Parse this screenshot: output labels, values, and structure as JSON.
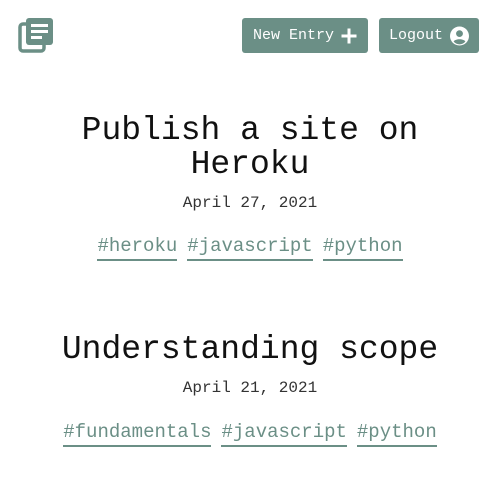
{
  "header": {
    "logo_icon": "journal-icon",
    "new_entry_label": "New Entry",
    "new_entry_icon": "plus-icon",
    "logout_label": "Logout",
    "logout_icon": "user-circle-icon"
  },
  "colors": {
    "accent": "#6b8f86",
    "text": "#111111"
  },
  "entries": [
    {
      "title": "Publish a site on Heroku",
      "date": "April 27, 2021",
      "tags": [
        "#heroku",
        "#javascript",
        "#python"
      ]
    },
    {
      "title": "Understanding scope",
      "date": "April 21, 2021",
      "tags": [
        "#fundamentals",
        "#javascript",
        "#python"
      ]
    }
  ]
}
